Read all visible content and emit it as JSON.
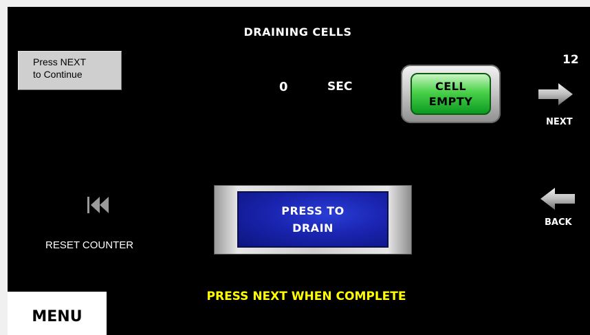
{
  "screen": {
    "title": "DRAINING CELLS",
    "page_number": "12"
  },
  "hint": {
    "line1": "Press NEXT",
    "line2": "to Continue"
  },
  "timer": {
    "value": "0",
    "unit": "SEC"
  },
  "status_indicator": {
    "line1": "CELL",
    "line2": "EMPTY",
    "color": "#2ecc40"
  },
  "navigation": {
    "next_label": "NEXT",
    "back_label": "BACK",
    "next_icon": "right-arrow-icon",
    "back_icon": "left-arrow-icon"
  },
  "reset": {
    "label": "RESET COUNTER",
    "icon": "skip-back-icon"
  },
  "drain_button": {
    "line1": "PRESS TO",
    "line2": "DRAIN",
    "color": "#1a24b0"
  },
  "instruction": {
    "text": "PRESS NEXT WHEN COMPLETE",
    "color": "#ffff00"
  },
  "menu": {
    "label": "MENU"
  }
}
